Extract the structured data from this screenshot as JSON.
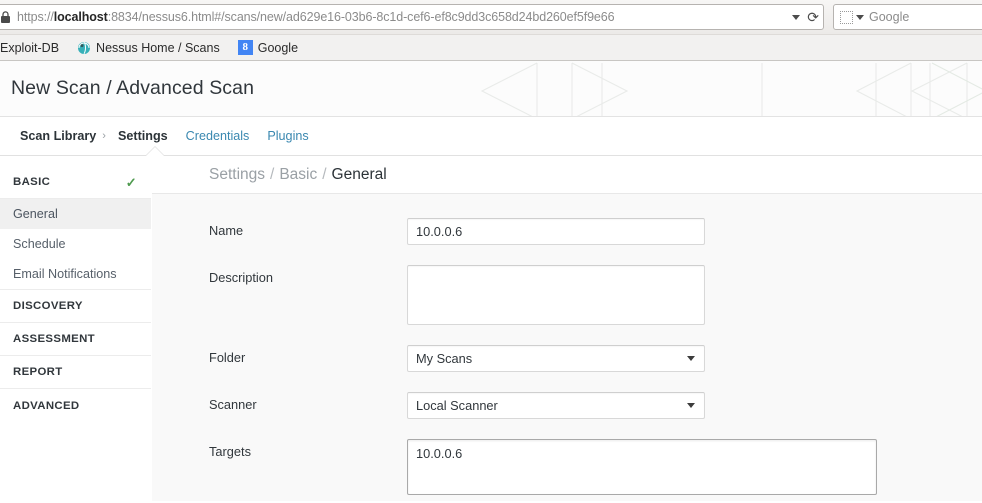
{
  "browser": {
    "url_prefix": "https://",
    "url_host": "localhost",
    "url_rest": ":8834/nessus6.html#/scans/new/ad629e16-03b6-8c1d-cef6-ef8c9dd3c658d24bd260ef5f9e66",
    "url_full": "https://localhost:8834/nessus6.html#/scans/new/ad629e16-03b6-8c1d-cef6-ef8c9dd3c658d24bd260ef5f9e66",
    "lock_icon": "lock-icon",
    "url_dropdown_icon": "chevron-down-icon",
    "reload_icon": "reload-icon",
    "search_engine_icon": "search-engine-icon",
    "search_dropdown_icon": "chevron-down-icon",
    "search_placeholder": "Google",
    "bookmarks": [
      {
        "label": "Exploit-DB",
        "icon": "exploitdb-favicon"
      },
      {
        "label": "Nessus Home / Scans",
        "icon": "nessus-favicon"
      },
      {
        "label": "Google",
        "icon": "google-favicon",
        "icon_glyph": "8"
      }
    ]
  },
  "app": {
    "page_title": "New Scan / Advanced Scan",
    "tabs": {
      "crumb": "Scan Library",
      "separator": "›",
      "items": [
        {
          "label": "Settings",
          "active": true
        },
        {
          "label": "Credentials",
          "active": false
        },
        {
          "label": "Plugins",
          "active": false
        }
      ]
    },
    "sidebar": {
      "groups": [
        {
          "label": "BASIC",
          "expanded": true,
          "check_icon": "check-icon",
          "items": [
            {
              "label": "General",
              "active": true
            },
            {
              "label": "Schedule",
              "active": false
            },
            {
              "label": "Email Notifications",
              "active": false
            }
          ]
        },
        {
          "label": "DISCOVERY",
          "expanded": false,
          "items": []
        },
        {
          "label": "ASSESSMENT",
          "expanded": false,
          "items": []
        },
        {
          "label": "REPORT",
          "expanded": false,
          "items": []
        },
        {
          "label": "ADVANCED",
          "expanded": false,
          "items": []
        }
      ]
    },
    "breadcrumb": {
      "part1": "Settings",
      "sep": "/",
      "part2": "Basic",
      "current": "General"
    },
    "form": {
      "name": {
        "label": "Name",
        "value": "10.0.0.6",
        "placeholder": ""
      },
      "description": {
        "label": "Description",
        "value": "",
        "placeholder": ""
      },
      "folder": {
        "label": "Folder",
        "value": "My Scans",
        "caret_icon": "chevron-down-icon"
      },
      "scanner": {
        "label": "Scanner",
        "value": "Local Scanner",
        "caret_icon": "chevron-down-icon"
      },
      "targets": {
        "label": "Targets",
        "value": "10.0.0.6",
        "placeholder": "",
        "focused": true
      }
    }
  },
  "colors": {
    "link_blue": "#3a88b0",
    "text_dark": "#31373c",
    "text_muted": "#9aa0a5",
    "check_green": "#4e9a4e",
    "panel_bg": "#f9f9f9",
    "active_item_bg": "#f0f0f0"
  }
}
